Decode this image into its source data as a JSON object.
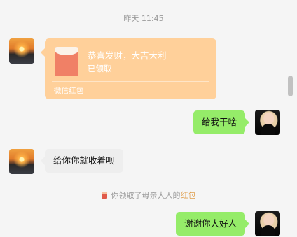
{
  "chat": {
    "timestamp": "昨天 11:45",
    "red_packet": {
      "title": "恭喜发财，大吉大利",
      "status": "已领取",
      "footer": "微信红包"
    },
    "messages": [
      {
        "side": "sent",
        "text": "给我干啥"
      },
      {
        "side": "recv",
        "text": "给你你就收着呗"
      },
      {
        "side": "sent",
        "text": "谢谢你大好人"
      }
    ],
    "notice": {
      "prefix": "你领取了母亲大人的",
      "highlight": "红包"
    }
  },
  "colors": {
    "sent_bubble": "#95ec69",
    "received_bubble": "#eeeeee",
    "red_packet_bg": "#ffd09a",
    "notice_highlight": "#e0a050"
  },
  "icons": {
    "contact_avatar": "sunset-avatar",
    "self_avatar": "portrait-avatar",
    "red_packet_icon": "red-envelope-icon"
  }
}
